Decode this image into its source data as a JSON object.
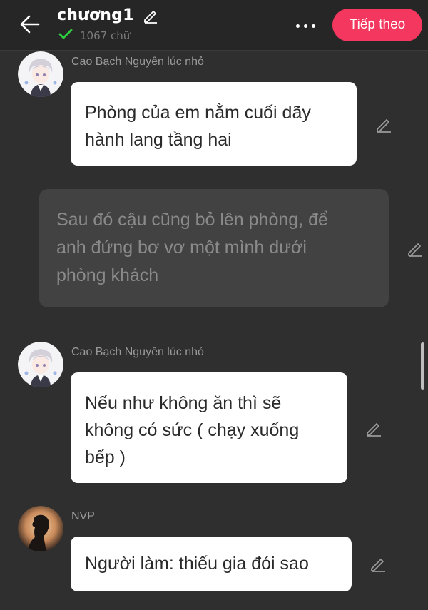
{
  "header": {
    "back_icon": "arrow-left-icon",
    "title": "chương1",
    "title_edit_icon": "pencil-icon",
    "word_count_icon": "check-icon",
    "word_count": "1067 chữ",
    "more_icon": "more-dots-icon",
    "next_label": "Tiếp theo",
    "accent_color": "#f3375f",
    "check_color": "#2ecc40"
  },
  "messages": [
    {
      "type": "dialogue",
      "speaker": "Cao Bạch Nguyên lúc nhỏ",
      "avatar": "anime-boy-avatar",
      "text_lines": [
        "Phòng của em nằm cuối dãy",
        "hành lang tầng hai"
      ],
      "edit_icon": "pencil-icon"
    },
    {
      "type": "narration",
      "text_lines": [
        "Sau đó cậu cũng bỏ lên phòng, để",
        "anh đứng bơ vơ một mình dưới",
        "phòng khách"
      ],
      "edit_icon": "pencil-icon"
    },
    {
      "type": "dialogue",
      "speaker": "Cao Bạch Nguyên lúc nhỏ",
      "avatar": "anime-boy-avatar",
      "text_lines": [
        "Nếu như không ăn thì sẽ",
        "không có sức ( chạy xuống",
        "bếp )"
      ],
      "edit_icon": "pencil-icon"
    },
    {
      "type": "dialogue",
      "speaker": "NVP",
      "avatar": "silhouette-avatar",
      "text_lines": [
        "Người làm: thiếu gia đói sao"
      ],
      "edit_icon": "pencil-icon"
    }
  ]
}
